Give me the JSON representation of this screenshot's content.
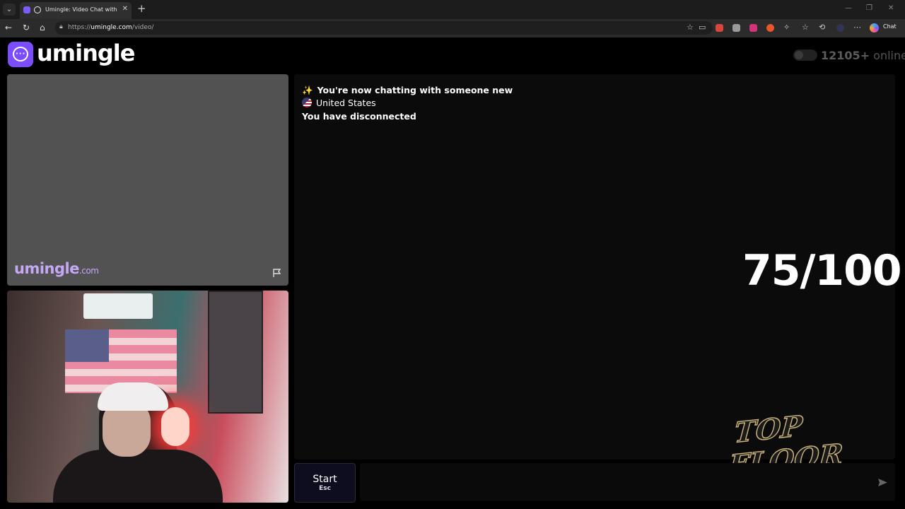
{
  "browser": {
    "tab_title": "Umingle: Video Chat with Strangers",
    "new_tab": "+",
    "tab_close": "✕",
    "url_prefix": "https://",
    "url_host": "umingle.com",
    "url_path": "/video/",
    "copilot_label": "Chat",
    "window_controls": [
      "—",
      "❐",
      "✕"
    ]
  },
  "header": {
    "logo_text": "umingle",
    "online_count": "12105+",
    "online_label": "online"
  },
  "video": {
    "watermark_main": "umingle",
    "watermark_suffix": ".com"
  },
  "chat": {
    "messages": [
      {
        "icon": "✨",
        "text": "You're now chatting with someone new"
      },
      {
        "icon": "us-flag",
        "text": "United States"
      },
      {
        "icon": "",
        "text": "You have disconnected"
      }
    ],
    "start_label": "Start",
    "start_shortcut": "Esc",
    "input_value": ""
  },
  "overlay": {
    "score": "75/100",
    "brand_line1": "TOP",
    "brand_line2": "FLOOR"
  },
  "colors": {
    "accent": "#7c4dff",
    "watermark": "#c5a8f5",
    "background": "#000000"
  }
}
